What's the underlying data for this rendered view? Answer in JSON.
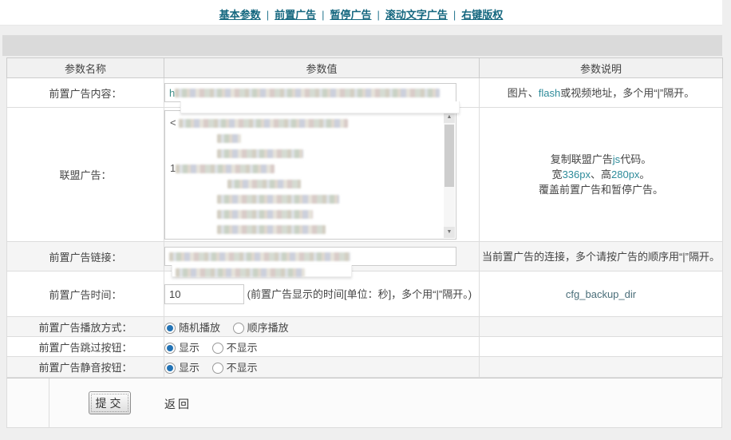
{
  "nav": {
    "separator": "|",
    "links": [
      {
        "label": "基本参数"
      },
      {
        "label": "前置广告"
      },
      {
        "label": "暂停广告"
      },
      {
        "label": "滚动文字广告"
      },
      {
        "label": "右键版权"
      }
    ]
  },
  "table": {
    "headers": {
      "name": "参数名称",
      "value": "参数值",
      "desc": "参数说明"
    },
    "rows": {
      "content": {
        "label": "前置广告内容：",
        "value_visible_prefix": "h",
        "desc": {
          "a": "图片、",
          "code": "flash",
          "b": "或视频地址，多个用“|”隔开。"
        }
      },
      "union": {
        "label": "联盟广告：",
        "value_line1_prefix": "<",
        "value_line4_prefix": "1",
        "desc": {
          "l1a": "复制联盟广告",
          "l1code": "js",
          "l1b": "代码。",
          "l2a": "宽",
          "l2code": "336px",
          "l2b": "、高",
          "l2code2": "280px",
          "l2c": "。",
          "l3": "覆盖前置广告和暂停广告。"
        }
      },
      "link": {
        "label": "前置广告链接：",
        "desc": "当前置广告的连接，多个请按广告的顺序用“|”隔开。"
      },
      "time": {
        "label": "前置广告时间：",
        "value": "10",
        "hint": "(前置广告显示的时间[单位：秒]，多个用“|”隔开。)",
        "desc": "cfg_backup_dir"
      },
      "playmode": {
        "label": "前置广告播放方式：",
        "options": [
          {
            "label": "随机播放",
            "selected": true
          },
          {
            "label": "顺序播放",
            "selected": false
          }
        ]
      },
      "skip": {
        "label": "前置广告跳过按钮：",
        "options": [
          {
            "label": "显示",
            "selected": true
          },
          {
            "label": "不显示",
            "selected": false
          }
        ]
      },
      "mute": {
        "label": "前置广告静音按钮：",
        "options": [
          {
            "label": "显示",
            "selected": true
          },
          {
            "label": "不显示",
            "selected": false
          }
        ]
      }
    }
  },
  "footer": {
    "submit_label": "提交",
    "back_label": "返回"
  },
  "colors": {
    "nav_link": "#15677f",
    "inline_code": "#2e8b9a",
    "radio_selected": "#2273b5",
    "band": "#dadada",
    "row_alt": "#f5f5f5"
  }
}
